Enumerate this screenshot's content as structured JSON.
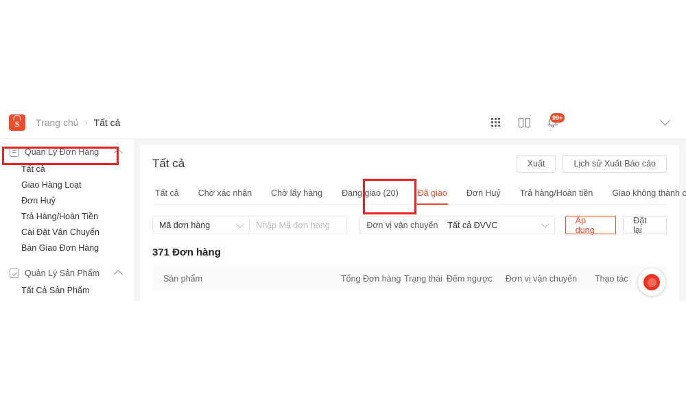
{
  "app": {
    "logo": "shopee-logo",
    "breadcrumb": {
      "home": "Trang chủ",
      "separator": "›",
      "current": "Tất cả"
    },
    "topbar_icons": [
      {
        "name": "apps-grid-icon",
        "label": "apps-grid"
      },
      {
        "name": "book-icon",
        "label": "book"
      },
      {
        "name": "notification-bell-icon",
        "label": "bell",
        "badge": "99+"
      }
    ],
    "topbar_caret": "chevron-down-icon"
  },
  "sidebar": {
    "groups": [
      {
        "title": "Quản Lý Đơn Hàng",
        "icon": "clipboard-icon",
        "expanded": true,
        "highlighted": true,
        "items": [
          "Tất cả",
          "Giao Hàng Loạt",
          "Đơn Huỷ",
          "Trả Hàng/Hoàn Tiền",
          "Cài Đặt Vận Chuyển",
          "Bàn Giao Đơn Hàng"
        ]
      },
      {
        "title": "Quản Lý Sản Phẩm",
        "icon": "checkbox-icon",
        "expanded": true,
        "highlighted": false,
        "items": [
          "Tất Cả Sản Phẩm"
        ]
      }
    ]
  },
  "main": {
    "title": "Tất cả",
    "actions": {
      "export": "Xuất",
      "export_history": "Lịch sử Xuất Báo cáo"
    },
    "tabs": [
      {
        "label": "Tất cả",
        "active": false
      },
      {
        "label": "Chờ xác nhận",
        "active": false
      },
      {
        "label": "Chờ lấy hàng",
        "active": false
      },
      {
        "label": "Đang giao (20)",
        "active": false
      },
      {
        "label": "Đã giao",
        "active": true
      },
      {
        "label": "Đơn Huỷ",
        "active": false
      },
      {
        "label": "Trả hàng/Hoàn tiền",
        "active": false
      },
      {
        "label": "Giao không thành công",
        "active": false
      }
    ],
    "filters": {
      "field_select": "Mã đơn hàng",
      "field_input_placeholder": "Nhập Mã đơn hàng",
      "field_input_value": "",
      "carrier_label": "Đơn vị vận chuyển",
      "carrier_value": "Tất cả ĐVVC",
      "apply": "Áp dụng",
      "reset": "Đặt lại"
    },
    "order_count": "371 Đơn hàng",
    "table": {
      "columns": [
        "Sản phẩm",
        "Tổng Đơn hàng",
        "Trạng thái",
        "Đếm ngược",
        "Đơn vị vận chuyển",
        "Thao tác"
      ]
    }
  },
  "overlay": {
    "record_button": "record-button",
    "annotations": [
      {
        "name": "annotation-sidebar-order-management",
        "color": "#ee2222"
      },
      {
        "name": "annotation-tab-da-giao",
        "color": "#ee2222"
      }
    ]
  },
  "colors": {
    "brand_orange": "#ee4d2d",
    "annotation_red": "#ee2222",
    "page_bg": "#ffffff",
    "content_bg": "#f5f5f5"
  }
}
